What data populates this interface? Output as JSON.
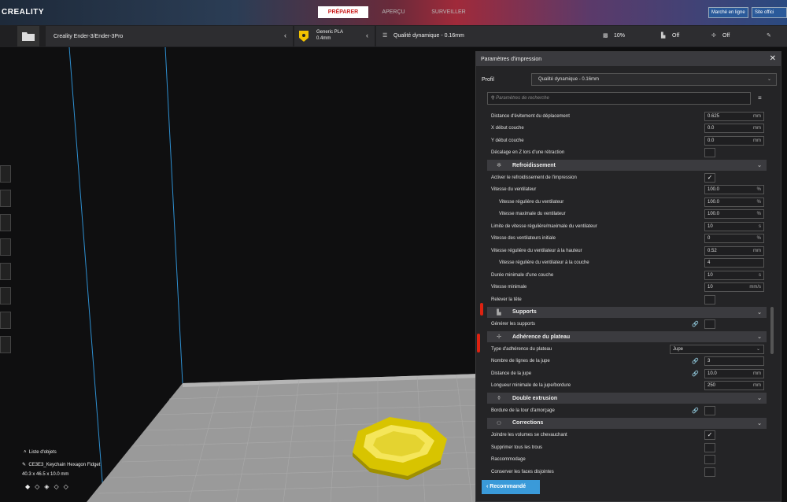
{
  "app": {
    "logo": "CREALITY"
  },
  "stages": [
    {
      "label": "PRÉPARER"
    },
    {
      "label": "APERÇU"
    },
    {
      "label": "SURVEILLER"
    }
  ],
  "top_right": {
    "marketplace": "Marché en ligne",
    "site": "Site offici"
  },
  "machine": {
    "name": "Creality Ender-3/Ender-3Pro"
  },
  "material": {
    "name": "Generic PLA",
    "nozzle": "0.4mm"
  },
  "quality": {
    "profile": "Qualité dynamique - 0.16mm",
    "infill": "10%",
    "support": "Off",
    "adhesion": "Off"
  },
  "objects": {
    "header": "Liste d'objets",
    "name": "CE3E3_Keychain Hexagon Fidget",
    "size": "40.3 x 46.5 x 10.0 mm"
  },
  "panel": {
    "title": "Paramètres d'impression",
    "profile_label": "Profil",
    "profile_value": "Qualité dynamique - 0.16mm",
    "search_placeholder": "Paramètres de recherche",
    "recommended": "Recommandé"
  },
  "settings": [
    {
      "t": "f",
      "label": "Distance d'évitement du déplacement",
      "value": "0.625",
      "unit": "mm"
    },
    {
      "t": "f",
      "label": "X début couche",
      "value": "0.0",
      "unit": "mm"
    },
    {
      "t": "f",
      "label": "Y début couche",
      "value": "0.0",
      "unit": "mm"
    },
    {
      "t": "c",
      "label": "Décalage en Z lors d'une rétraction",
      "checked": ""
    },
    {
      "t": "cat",
      "label": "Refroidissement",
      "icon": "✻"
    },
    {
      "t": "c",
      "label": "Activer le refroidissement de l'impression",
      "checked": "✓"
    },
    {
      "t": "f",
      "label": "Vitesse du ventilateur",
      "value": "100.0",
      "unit": "%"
    },
    {
      "t": "f",
      "label": "Vitesse régulière du ventilateur",
      "value": "100.0",
      "unit": "%",
      "ind": 1
    },
    {
      "t": "f",
      "label": "Vitesse maximale du ventilateur",
      "value": "100.0",
      "unit": "%",
      "ind": 1
    },
    {
      "t": "f",
      "label": "Limite de vitesse régulière/maximale du ventilateur",
      "value": "10",
      "unit": "s"
    },
    {
      "t": "f",
      "label": "Vitesse des ventilateurs initiale",
      "value": "0",
      "unit": "%"
    },
    {
      "t": "f",
      "label": "Vitesse régulière du ventilateur à la hauteur",
      "value": "0.52",
      "unit": "mm"
    },
    {
      "t": "f",
      "label": "Vitesse régulière du ventilateur à la couche",
      "value": "4",
      "unit": "",
      "ind": 1
    },
    {
      "t": "f",
      "label": "Durée minimale d'une couche",
      "value": "10",
      "unit": "s"
    },
    {
      "t": "f",
      "label": "Vitesse minimale",
      "value": "10",
      "unit": "mm/s"
    },
    {
      "t": "c",
      "label": "Relever la tête",
      "checked": ""
    },
    {
      "t": "cat",
      "label": "Supports",
      "icon": "▙"
    },
    {
      "t": "c",
      "label": "Générer les supports",
      "checked": "",
      "link": 1
    },
    {
      "t": "cat",
      "label": "Adhérence du plateau",
      "icon": "✢"
    },
    {
      "t": "s",
      "label": "Type d'adhérence du plateau",
      "value": "Jupe"
    },
    {
      "t": "f",
      "label": "Nombre de lignes de la jupe",
      "value": "3",
      "unit": "",
      "link": 1
    },
    {
      "t": "f",
      "label": "Distance de la jupe",
      "value": "10.0",
      "unit": "mm",
      "link": 1
    },
    {
      "t": "f",
      "label": "Longueur minimale de la jupe/bordure",
      "value": "250",
      "unit": "mm"
    },
    {
      "t": "cat",
      "label": "Double extrusion",
      "icon": "⚱"
    },
    {
      "t": "c",
      "label": "Bordure de la tour d'amorçage",
      "checked": "",
      "link": 1
    },
    {
      "t": "cat",
      "label": "Corrections",
      "icon": "⚇"
    },
    {
      "t": "c",
      "label": "Joindre les volumes se chevauchant",
      "checked": "✓"
    },
    {
      "t": "c",
      "label": "Supprimer tous les trous",
      "checked": ""
    },
    {
      "t": "c",
      "label": "Raccommodage",
      "checked": ""
    },
    {
      "t": "c",
      "label": "Conserver les faces disjointes",
      "checked": ""
    }
  ]
}
